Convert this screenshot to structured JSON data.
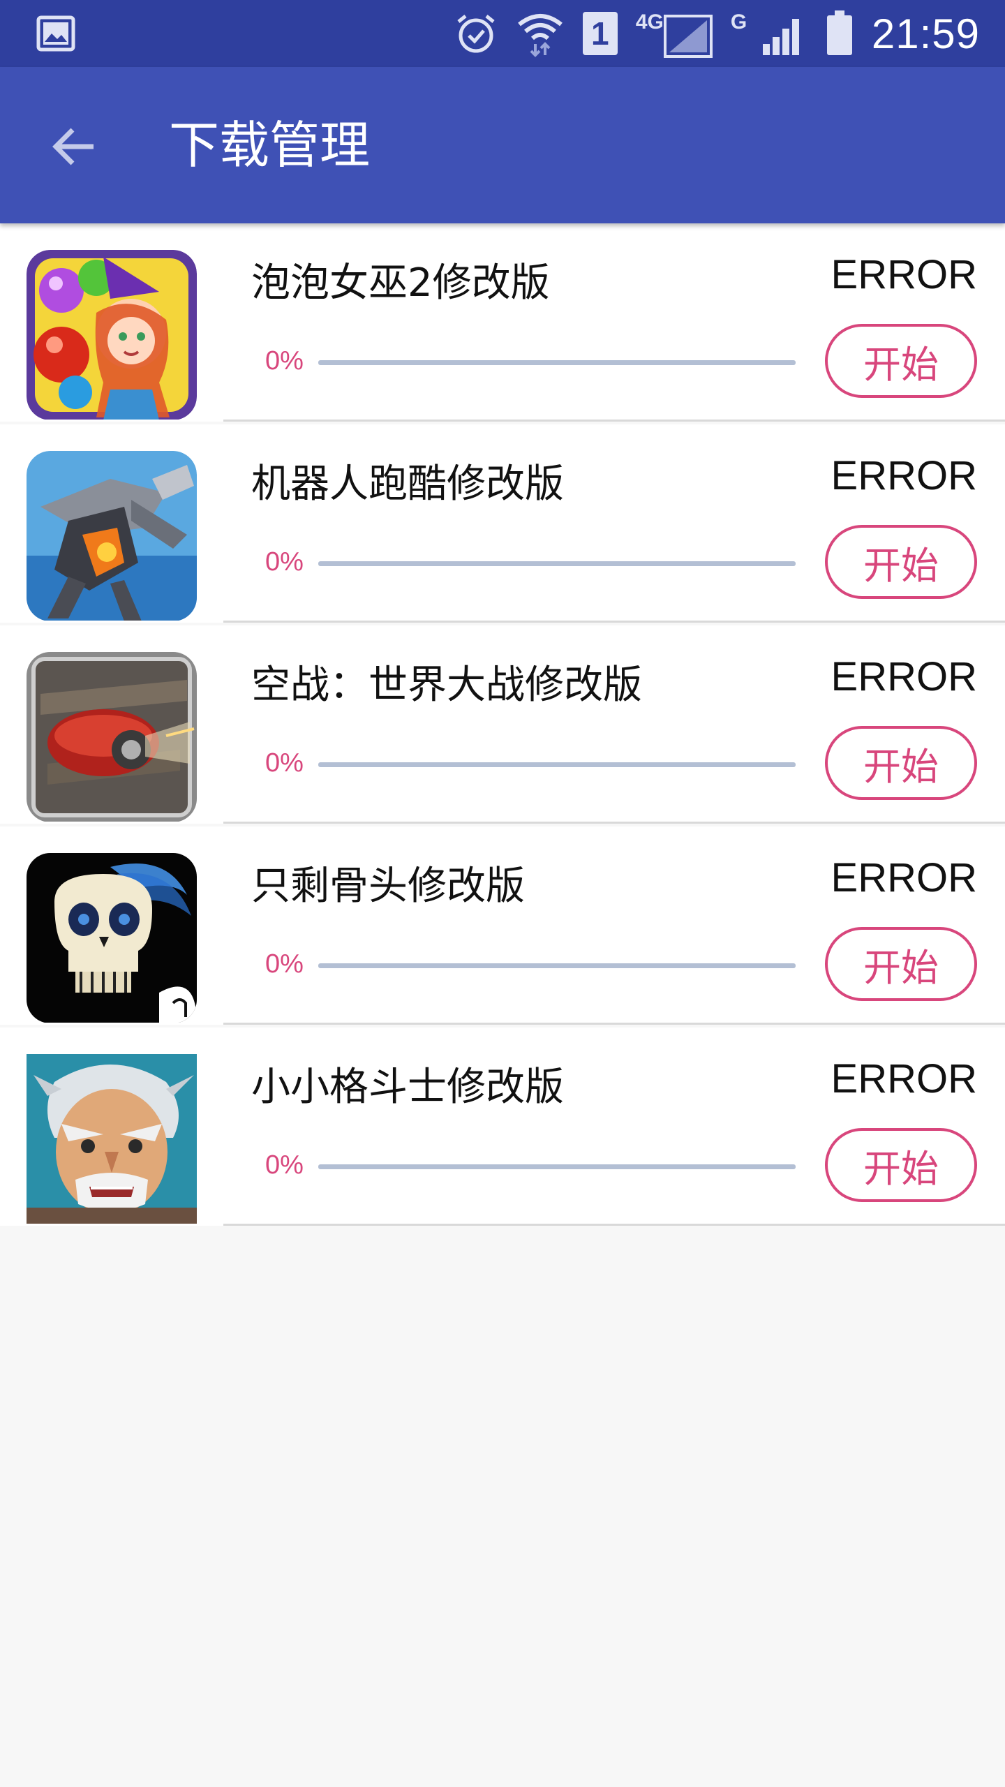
{
  "status_bar": {
    "time": "21:59",
    "network_label": "4G",
    "network_label_2": "G",
    "sim_label": "1",
    "icons": [
      "gallery-icon",
      "alarm-icon",
      "wifi-icon",
      "sim-icon",
      "signal-icon",
      "signal-icon",
      "battery-icon"
    ]
  },
  "app_bar": {
    "title": "下载管理",
    "back_icon": "arrow-left-icon"
  },
  "colors": {
    "status_bar": "#2f3f9e",
    "app_bar": "#3f51b5",
    "accent": "#d8467c",
    "track": "#b3bfd4",
    "background": "#f7f7f7"
  },
  "downloads": [
    {
      "name": "泡泡女巫2修改版",
      "state": "ERROR",
      "percent": "0%",
      "progress": 0,
      "button": "开始",
      "icon": "bubble-witch-icon"
    },
    {
      "name": "机器人跑酷修改版",
      "state": "ERROR",
      "percent": "0%",
      "progress": 0,
      "button": "开始",
      "icon": "robot-runner-icon"
    },
    {
      "name": "空战：世界大战修改版",
      "state": "ERROR",
      "percent": "0%",
      "progress": 0,
      "button": "开始",
      "icon": "warplane-icon"
    },
    {
      "name": "只剩骨头修改版",
      "state": "ERROR",
      "percent": "0%",
      "progress": 0,
      "button": "开始",
      "icon": "skull-icon"
    },
    {
      "name": "小小格斗士修改版",
      "state": "ERROR",
      "percent": "0%",
      "progress": 0,
      "button": "开始",
      "icon": "fighter-icon"
    }
  ]
}
